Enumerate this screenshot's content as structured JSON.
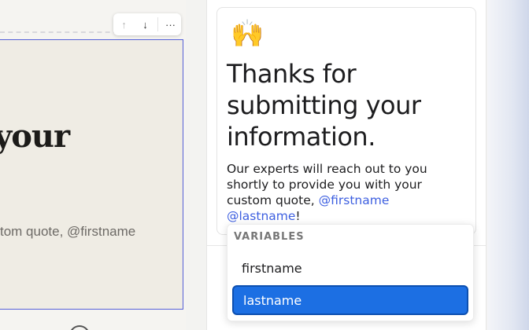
{
  "editor": {
    "heading_fragment": "your",
    "body_fragment": "tom quote, @firstname"
  },
  "toolbar": {
    "move_up_icon": "↑",
    "move_down_icon": "↓",
    "more_icon": "···"
  },
  "preview": {
    "emoji": "🙌",
    "title": "Thanks for submitting your information.",
    "body_text": "Our experts will reach out to you shortly to provide you with your custom quote, ",
    "var_firstname": "@firstname",
    "var_lastname": "@lastname",
    "body_end": "!"
  },
  "variables_menu": {
    "header": "VARIABLES",
    "items": [
      {
        "label": "firstname",
        "selected": false
      },
      {
        "label": "lastname",
        "selected": true
      }
    ]
  },
  "colors": {
    "accent": "#1c6fe3",
    "variable_text": "#3d5fe0",
    "selection_border": "#5560d8"
  }
}
